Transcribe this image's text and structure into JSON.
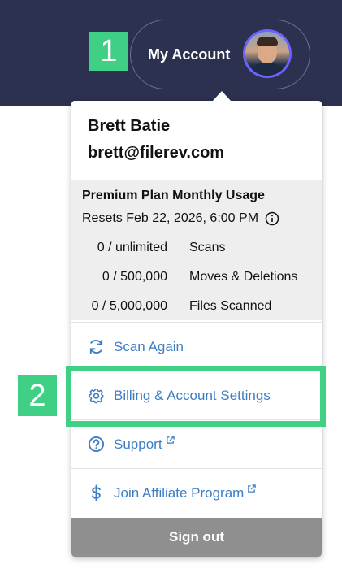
{
  "steps": {
    "one": "1",
    "two": "2"
  },
  "account_button": {
    "label": "My Account",
    "avatar": "user-avatar-photo"
  },
  "dropdown": {
    "user_name": "Brett Batie",
    "user_email": "brett@filerev.com",
    "usage": {
      "title": "Premium Plan Monthly Usage",
      "reset_text": "Resets Feb 22, 2026, 6:00 PM",
      "rows": [
        {
          "value": "0 / unlimited",
          "name": "Scans"
        },
        {
          "value": "0 / 500,000",
          "name": "Moves & Deletions"
        },
        {
          "value": "0 / 5,000,000",
          "name": "Files Scanned"
        }
      ]
    },
    "menu": [
      {
        "label": "Scan Again",
        "icon": "refresh-icon",
        "external": false
      },
      {
        "label": "Billing & Account Settings",
        "icon": "gear-icon",
        "external": false
      },
      {
        "label": "Support",
        "icon": "help-circle-icon",
        "external": true
      },
      {
        "label": "Join Affiliate Program",
        "icon": "dollar-icon",
        "external": true
      }
    ],
    "sign_out": "Sign out"
  },
  "colors": {
    "topbar": "#2d3150",
    "accent_green": "#3fcf85",
    "link_blue": "#3c7ec4",
    "signout_gray": "#8f8f8f",
    "usage_bg": "#eeeeee"
  }
}
